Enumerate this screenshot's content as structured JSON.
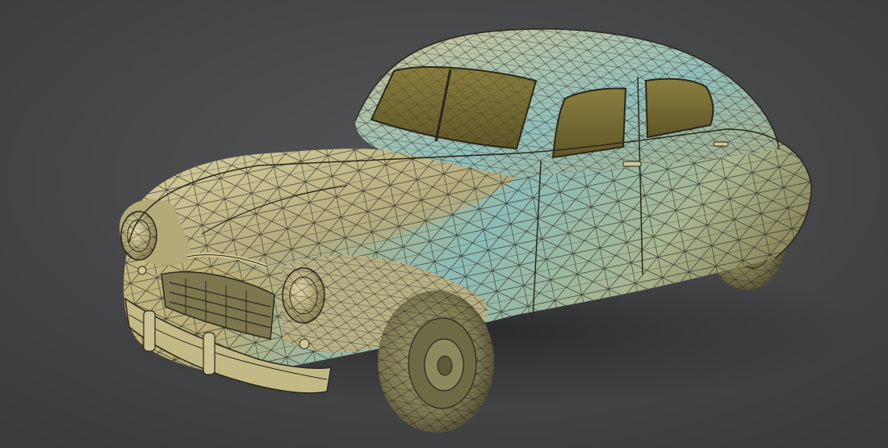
{
  "scene": {
    "subject": "render-of-wireframe-vintage-sedan",
    "colors": {
      "background": "#4a4b4c",
      "background_vignette": "#3a3b3c",
      "body_warm": "#b9ae7c",
      "body_highlight": "#d6cf9e",
      "body_cool": "#7fb8b6",
      "body_shadow": "#6f6a45",
      "glass": "#8c7f3e",
      "glass_dark": "#4e4727",
      "tire": "#8f8a62",
      "tire_dark": "#4c4830",
      "chrome": "#a8a079",
      "wire": "#1b1b14",
      "ground_shadow": "#2f3031"
    }
  }
}
